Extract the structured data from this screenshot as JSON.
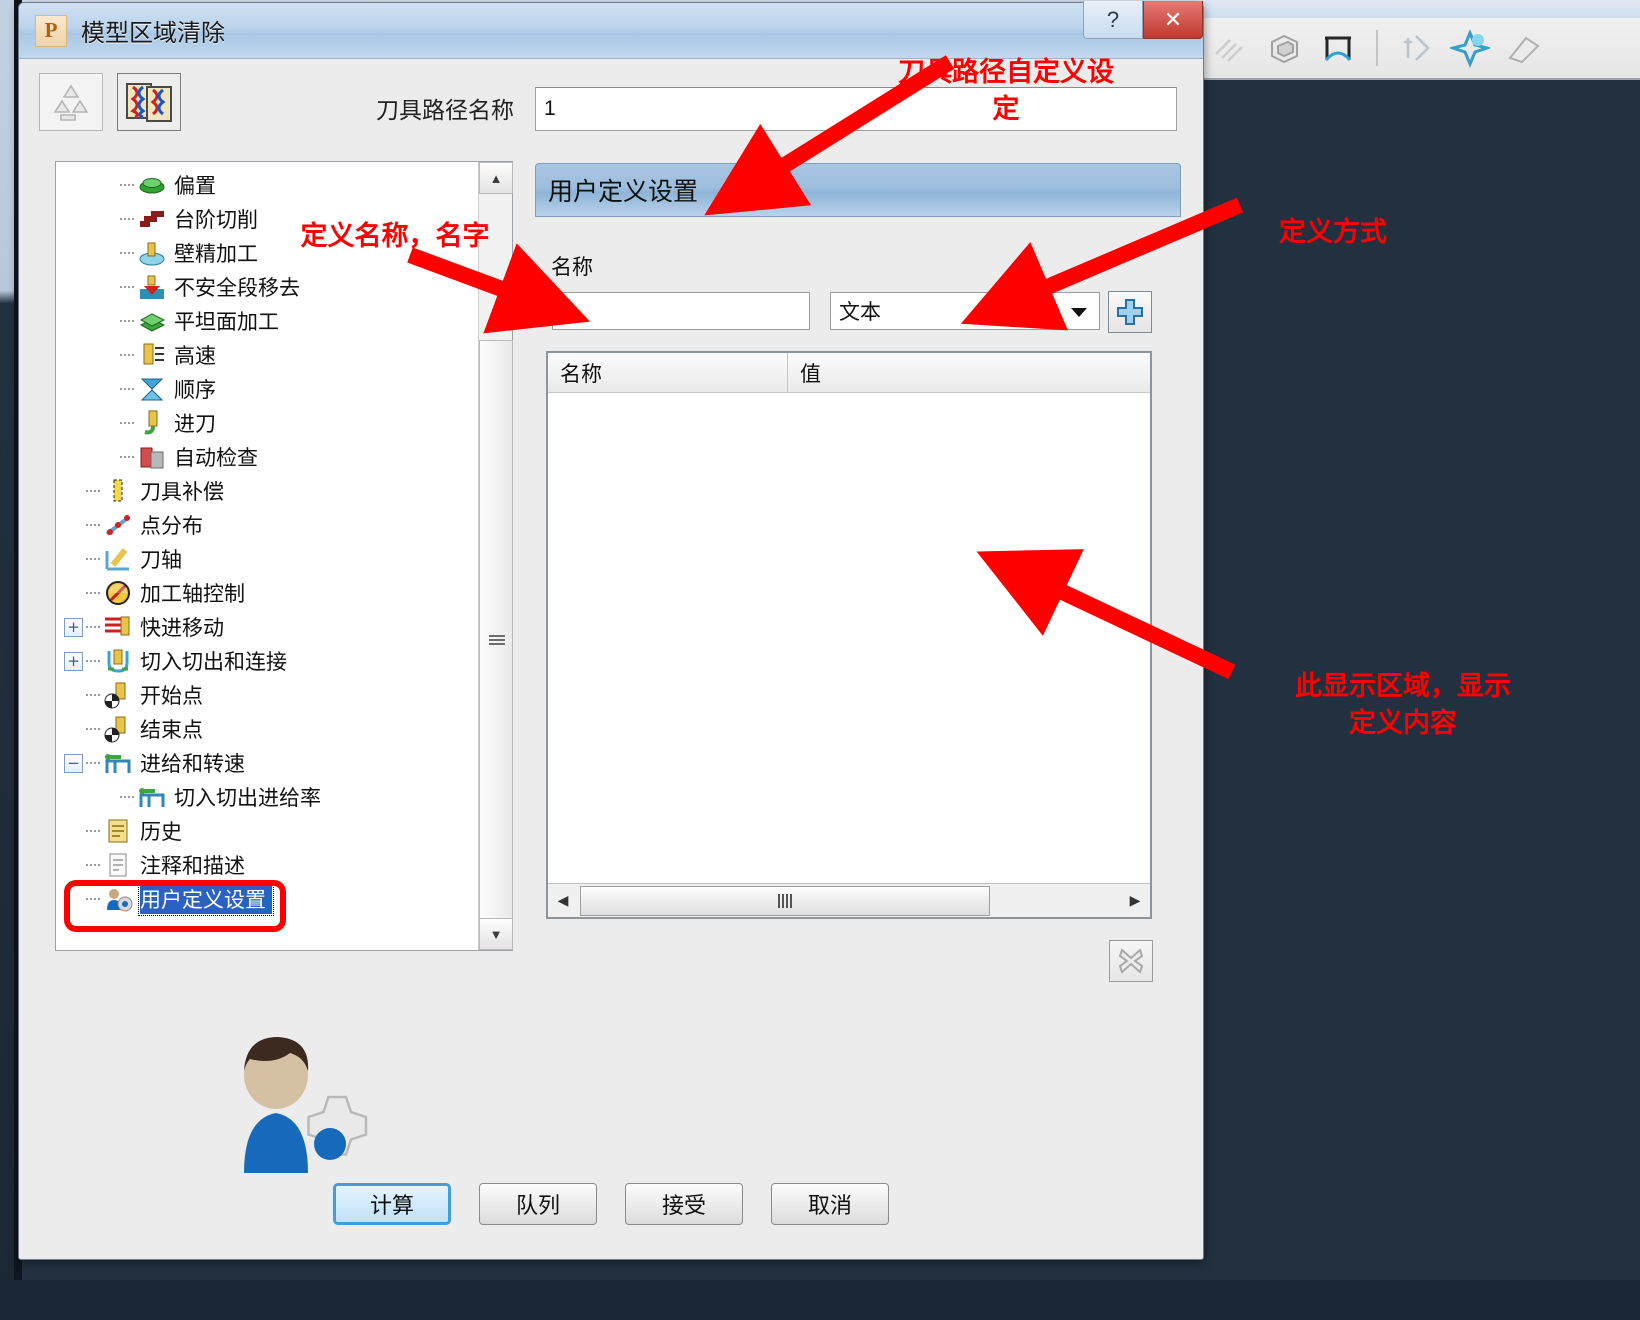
{
  "window": {
    "title": "模型区域清除",
    "app_icon_letter": "P",
    "help_button": "?",
    "close_button": "✕"
  },
  "toolbar": {
    "recycle_icon": "recycle-icon",
    "preview_icon": "toolpath-preview-icon"
  },
  "toolpath": {
    "name_label": "刀具路径名称",
    "name_value": "1",
    "name_placeholder": ""
  },
  "tree": {
    "items": [
      {
        "label": "偏置",
        "indent": 2,
        "icon": "offset-icon",
        "expander": "",
        "selected": false
      },
      {
        "label": "台阶切削",
        "indent": 2,
        "icon": "step-cut-icon",
        "expander": "",
        "selected": false
      },
      {
        "label": "壁精加工",
        "indent": 2,
        "icon": "wall-finish-icon",
        "expander": "",
        "selected": false
      },
      {
        "label": "不安全段移去",
        "indent": 2,
        "icon": "unsafe-segment-remove-icon",
        "expander": "",
        "selected": false
      },
      {
        "label": "平坦面加工",
        "indent": 2,
        "icon": "flat-face-icon",
        "expander": "",
        "selected": false
      },
      {
        "label": "高速",
        "indent": 2,
        "icon": "high-speed-icon",
        "expander": "",
        "selected": false
      },
      {
        "label": "顺序",
        "indent": 2,
        "icon": "order-icon",
        "expander": "",
        "selected": false
      },
      {
        "label": "进刀",
        "indent": 2,
        "icon": "plunge-icon",
        "expander": "",
        "selected": false
      },
      {
        "label": "自动检查",
        "indent": 2,
        "icon": "auto-check-icon",
        "expander": "",
        "selected": false
      },
      {
        "label": "刀具补偿",
        "indent": 1,
        "icon": "tool-compensation-icon",
        "expander": "",
        "selected": false
      },
      {
        "label": "点分布",
        "indent": 1,
        "icon": "point-distribution-icon",
        "expander": "",
        "selected": false
      },
      {
        "label": "刀轴",
        "indent": 1,
        "icon": "tool-axis-icon",
        "expander": "",
        "selected": false
      },
      {
        "label": "加工轴控制",
        "indent": 1,
        "icon": "machine-axis-control-icon",
        "expander": "",
        "selected": false
      },
      {
        "label": "快进移动",
        "indent": 1,
        "icon": "rapid-move-icon",
        "expander": "+",
        "selected": false
      },
      {
        "label": "切入切出和连接",
        "indent": 1,
        "icon": "lead-link-icon",
        "expander": "+",
        "selected": false
      },
      {
        "label": "开始点",
        "indent": 1,
        "icon": "start-point-icon",
        "expander": "",
        "selected": false
      },
      {
        "label": "结束点",
        "indent": 1,
        "icon": "end-point-icon",
        "expander": "",
        "selected": false
      },
      {
        "label": "进给和转速",
        "indent": 1,
        "icon": "feeds-speeds-icon",
        "expander": "−",
        "selected": false
      },
      {
        "label": "切入切出进给率",
        "indent": 2,
        "icon": "lead-feedrate-icon",
        "expander": "",
        "selected": false
      },
      {
        "label": "历史",
        "indent": 1,
        "icon": "history-icon",
        "expander": "",
        "selected": false
      },
      {
        "label": "注释和描述",
        "indent": 1,
        "icon": "notes-icon",
        "expander": "",
        "selected": false
      },
      {
        "label": "用户定义设置",
        "indent": 1,
        "icon": "user-defined-settings-icon",
        "expander": "",
        "selected": true
      }
    ],
    "scroll_up_arrow": "▲",
    "scroll_down_arrow": "▼"
  },
  "panel": {
    "header": "用户定义设置",
    "name_label": "名称",
    "name_value": "",
    "type_value": "文本",
    "add_button_icon": "plus-icon",
    "delete_button_icon": "delete-x-icon",
    "illustration_icon": "user-settings-person-gear-icon"
  },
  "table": {
    "columns": [
      "名称",
      "值"
    ],
    "rows": [],
    "hscroll_left_arrow": "◀",
    "hscroll_right_arrow": "▶"
  },
  "buttons": {
    "calculate": "计算",
    "queue": "队列",
    "accept": "接受",
    "cancel": "取消"
  },
  "annotations": [
    {
      "id": "anno-toolpath-custom",
      "text": "刀具路径自定义设\n定"
    },
    {
      "id": "anno-define-name",
      "text": "定义名称，名字"
    },
    {
      "id": "anno-define-method",
      "text": "定义方式"
    },
    {
      "id": "anno-display-area",
      "text": "此显示区域，显示\n定义内容"
    }
  ],
  "colors": {
    "annotation": "#ff0000",
    "selection": "#2a62c4",
    "accent_button_border": "#3f9ede",
    "titlebar": "#bcd4ec",
    "background": "#22303f"
  }
}
